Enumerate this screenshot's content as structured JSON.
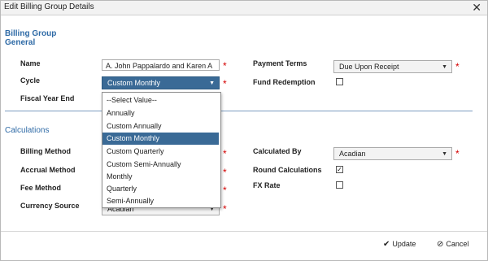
{
  "dialog": {
    "title": "Edit Billing Group Details",
    "close_glyph": "✕"
  },
  "sections": {
    "billing_group": "Billing Group",
    "general": "General",
    "calculations": "Calculations"
  },
  "general": {
    "name_label": "Name",
    "name_value": "A. John Pappalardo and Karen A",
    "cycle_label": "Cycle",
    "cycle_value": "Custom Monthly",
    "fiscal_year_end_label": "Fiscal Year End",
    "payment_terms_label": "Payment Terms",
    "payment_terms_value": "Due Upon Receipt",
    "fund_redemption_label": "Fund Redemption",
    "fund_redemption_checked": false
  },
  "calculations": {
    "billing_method_label": "Billing Method",
    "accrual_method_label": "Accrual Method",
    "fee_method_label": "Fee Method",
    "currency_source_label": "Currency Source",
    "currency_source_value": "Acadian",
    "calculated_by_label": "Calculated By",
    "calculated_by_value": "Acadian",
    "round_calculations_label": "Round Calculations",
    "round_calculations_checked": true,
    "fx_rate_label": "FX Rate",
    "fx_rate_checked": false
  },
  "cycle_dropdown": {
    "options": [
      "--Select Value--",
      "Annually",
      "Custom Annually",
      "Custom Monthly",
      "Custom Quarterly",
      "Custom Semi-Annually",
      "Monthly",
      "Quarterly",
      "Semi-Annually"
    ],
    "selected": "Custom Monthly"
  },
  "footer": {
    "update_label": "Update",
    "cancel_label": "Cancel",
    "update_icon": "check-icon",
    "cancel_icon": "cancel-icon"
  },
  "colors": {
    "accent": "#2e6aa6",
    "selection": "#3a6a96",
    "required": "#d40000"
  },
  "symbols": {
    "required": "*",
    "check": "✓",
    "update_glyph": "✔",
    "cancel_glyph": "⊘",
    "arrow": "▼"
  }
}
